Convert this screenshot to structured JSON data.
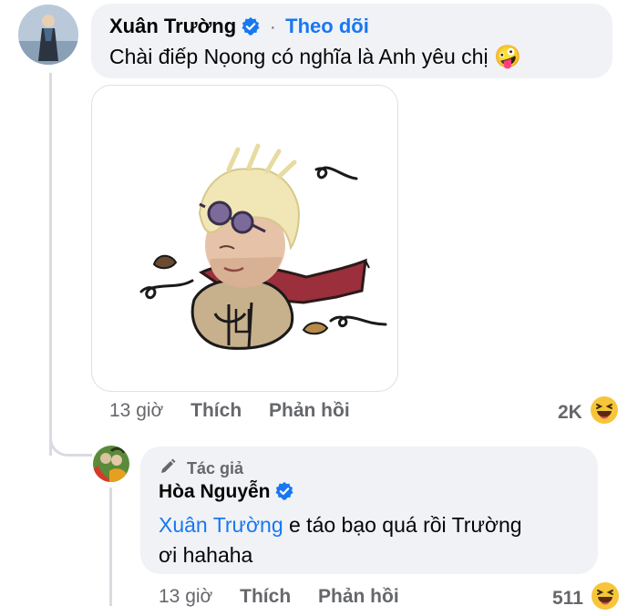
{
  "comment1": {
    "author": "Xuân Trường",
    "follow_label": "Theo dõi",
    "separator": "·",
    "text": "Chài điếp Nọong có nghĩa là Anh yêu chị",
    "emoji": "🤪",
    "time": "13 giờ",
    "like_label": "Thích",
    "reply_label": "Phản hồi",
    "reaction_count": "2K",
    "reaction_emoji": "😆"
  },
  "reply1": {
    "author_badge": "Tác giả",
    "author": "Hòa Nguyễn",
    "mention": "Xuân Trường",
    "text_line1": "e táo bạo quá rồi Trường",
    "text_line2": "ơi hahaha",
    "time": "13 giờ",
    "like_label": "Thích",
    "reply_label": "Phản hồi",
    "reaction_count": "511",
    "reaction_emoji": "😆"
  },
  "colors": {
    "accent": "#1877f2",
    "bubble": "#f0f2f5",
    "muted": "#65676b"
  },
  "icons": [
    "verified-badge-icon",
    "pencil-icon",
    "haha-reaction-icon"
  ]
}
